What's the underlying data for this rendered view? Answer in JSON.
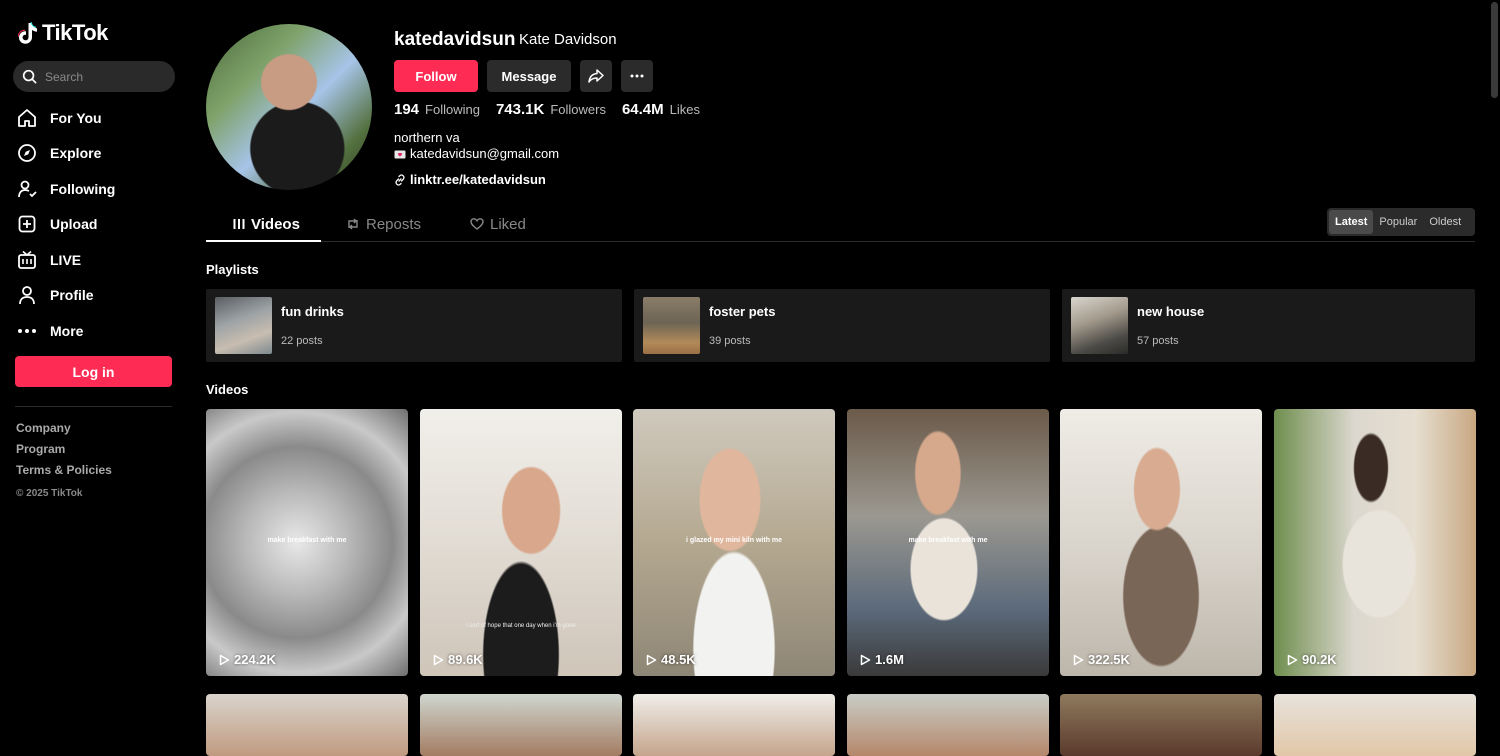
{
  "brand": {
    "name": "TikTok"
  },
  "search": {
    "placeholder": "Search"
  },
  "nav": {
    "items": [
      {
        "label": "For You",
        "icon": "home-icon"
      },
      {
        "label": "Explore",
        "icon": "compass-icon"
      },
      {
        "label": "Following",
        "icon": "following-icon"
      },
      {
        "label": "Upload",
        "icon": "upload-icon"
      },
      {
        "label": "LIVE",
        "icon": "live-icon"
      },
      {
        "label": "Profile",
        "icon": "profile-icon"
      },
      {
        "label": "More",
        "icon": "more-icon"
      }
    ]
  },
  "login_label": "Log in",
  "footer": {
    "links": [
      "Company",
      "Program",
      "Terms & Policies"
    ],
    "copyright": "© 2025 TikTok"
  },
  "profile": {
    "username": "katedavidsun",
    "display_name": "Kate Davidson",
    "follow_label": "Follow",
    "message_label": "Message",
    "stats": {
      "following_count": "194",
      "following_label": "Following",
      "followers_count": "743.1K",
      "followers_label": "Followers",
      "likes_count": "64.4M",
      "likes_label": "Likes"
    },
    "bio_location": "northern va",
    "bio_email": "katedavidsun@gmail.com",
    "link": "linktr.ee/katedavidsun"
  },
  "tabs": [
    {
      "label": "Videos",
      "icon": "grid-icon"
    },
    {
      "label": "Reposts",
      "icon": "repost-icon"
    },
    {
      "label": "Liked",
      "icon": "heart-icon"
    }
  ],
  "sort": {
    "options": [
      "Latest",
      "Popular",
      "Oldest"
    ],
    "selected": "Latest"
  },
  "playlists_title": "Playlists",
  "playlists": [
    {
      "name": "fun drinks",
      "count": "22 posts"
    },
    {
      "name": "foster pets",
      "count": "39 posts"
    },
    {
      "name": "new house",
      "count": "57 posts"
    }
  ],
  "videos_title": "Videos",
  "videos": [
    {
      "views": "224.2K",
      "caption": "make breakfast with me",
      "caption2": ""
    },
    {
      "views": "89.6K",
      "caption": "",
      "caption2": "i sort of hope that one day when i'm gone"
    },
    {
      "views": "48.5K",
      "caption": "i glazed my mini kiln with me",
      "caption2": ""
    },
    {
      "views": "1.6M",
      "caption": "make breakfast with me",
      "caption2": ""
    },
    {
      "views": "322.5K",
      "caption": "",
      "caption2": ""
    },
    {
      "views": "90.2K",
      "caption": "",
      "caption2": ""
    }
  ],
  "colors": {
    "accent": "#fe2c55",
    "background": "#000000",
    "surface": "#1a1a1a"
  }
}
